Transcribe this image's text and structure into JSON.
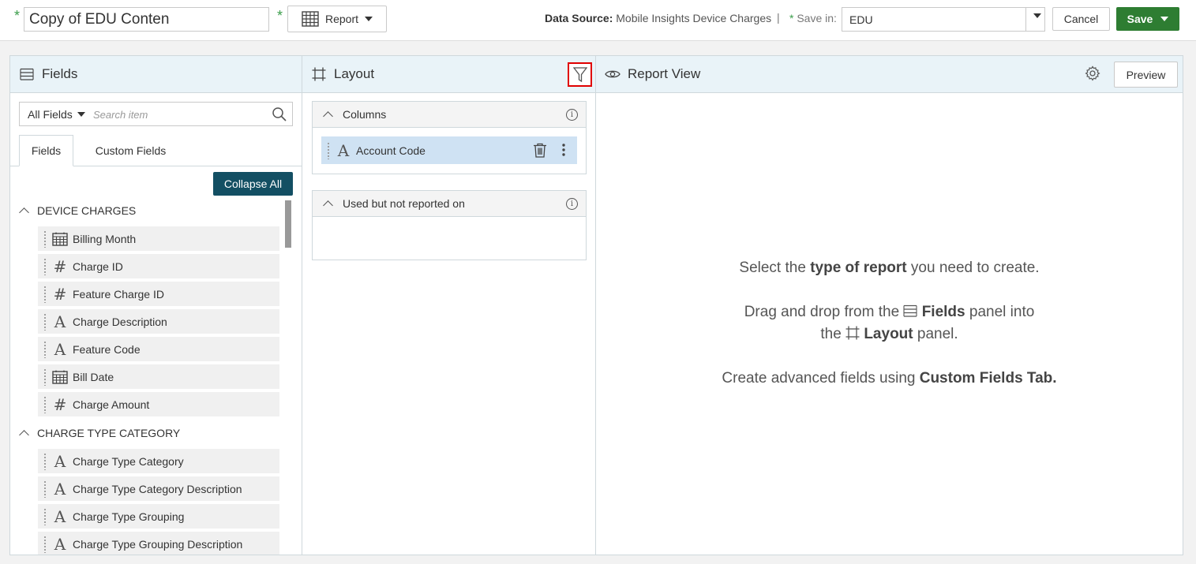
{
  "header": {
    "report_name": "Copy of EDU Conten",
    "report_type_label": "Report",
    "data_source_label": "Data Source:",
    "data_source_value": "Mobile Insights Device Charges",
    "separator": "|",
    "save_in_label": "Save in:",
    "save_in_value": "EDU",
    "cancel_label": "Cancel",
    "save_label": "Save",
    "required_mark": "*"
  },
  "fields_panel": {
    "title": "Fields",
    "filter_value": "All Fields",
    "search_placeholder": "Search item",
    "tabs": [
      "Fields",
      "Custom Fields"
    ],
    "collapse_all_label": "Collapse All",
    "groups": [
      {
        "title": "DEVICE CHARGES",
        "items": [
          {
            "label": "Billing Month",
            "icon": "calendar-icon"
          },
          {
            "label": "Charge ID",
            "icon": "number-icon"
          },
          {
            "label": "Feature Charge ID",
            "icon": "number-icon"
          },
          {
            "label": "Charge Description",
            "icon": "text-icon"
          },
          {
            "label": "Feature Code",
            "icon": "text-icon"
          },
          {
            "label": "Bill Date",
            "icon": "calendar-icon"
          },
          {
            "label": "Charge Amount",
            "icon": "number-icon"
          }
        ]
      },
      {
        "title": "CHARGE TYPE CATEGORY",
        "items": [
          {
            "label": "Charge Type Category",
            "icon": "text-icon"
          },
          {
            "label": "Charge Type Category Description",
            "icon": "text-icon"
          },
          {
            "label": "Charge Type Grouping",
            "icon": "text-icon"
          },
          {
            "label": "Charge Type Grouping Description",
            "icon": "text-icon"
          }
        ]
      }
    ]
  },
  "layout_panel": {
    "title": "Layout",
    "columns_title": "Columns",
    "column_item": "Account Code",
    "unreported_title": "Used but not reported on"
  },
  "report_view": {
    "title": "Report View",
    "preview_label": "Preview",
    "line1_pre": "Select the ",
    "line1_bold": "type of report",
    "line1_post": " you need to create.",
    "line2_pre": "Drag and drop from the ",
    "line2_bold": "Fields",
    "line2_post": " panel into",
    "line3_pre": "the ",
    "line3_bold": "Layout",
    "line3_post": " panel.",
    "line4_pre": "Create advanced fields using ",
    "line4_bold": "Custom Fields Tab."
  },
  "colors": {
    "accent_green": "#2e7d32",
    "collapse_btn": "#134f63",
    "panel_header": "#e9f3f8",
    "selected_item": "#cfe2f3",
    "highlight_border": "#e00000"
  }
}
